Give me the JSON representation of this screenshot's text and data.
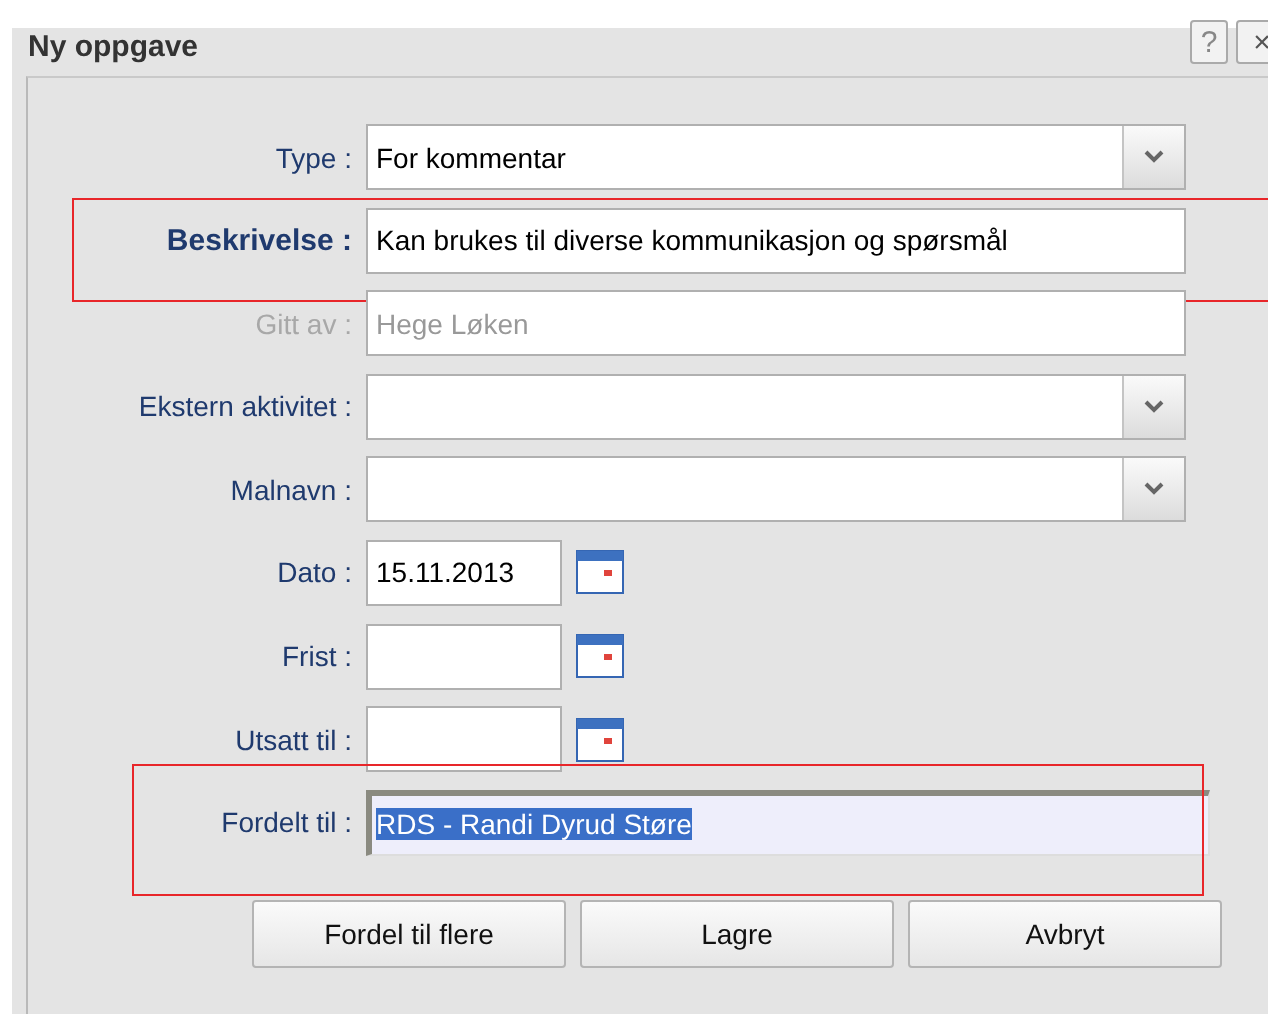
{
  "window": {
    "title": "Ny oppgave"
  },
  "title_buttons": [
    {
      "kind": "help",
      "label": "?"
    },
    {
      "kind": "close",
      "label": "×"
    }
  ],
  "fields": [
    {
      "kind": "dropdown",
      "label": "Type :",
      "value": "For kommentar",
      "emphasized": false,
      "disabled": false,
      "highlighted": false,
      "text_selected": false
    },
    {
      "kind": "text",
      "label": "Beskrivelse :",
      "value": "Kan brukes til diverse kommunikasjon og spørsmål",
      "emphasized": true,
      "disabled": false,
      "highlighted": true,
      "text_selected": false
    },
    {
      "kind": "text",
      "label": "Gitt av :",
      "value": "Hege Løken",
      "emphasized": false,
      "disabled": true,
      "highlighted": false,
      "text_selected": false
    },
    {
      "kind": "dropdown",
      "label": "Ekstern aktivitet :",
      "emphasized": false,
      "disabled": false,
      "highlighted": false,
      "text_selected": false
    },
    {
      "kind": "dropdown",
      "label": "Malnavn :",
      "emphasized": false,
      "disabled": false,
      "highlighted": false,
      "text_selected": false
    },
    {
      "kind": "date",
      "label": "Dato :",
      "value": "15.11.2013",
      "emphasized": false,
      "disabled": false,
      "highlighted": false,
      "text_selected": false
    },
    {
      "kind": "date",
      "label": "Frist :",
      "emphasized": false,
      "disabled": false,
      "highlighted": false,
      "text_selected": false
    },
    {
      "kind": "date",
      "label": "Utsatt til :",
      "emphasized": false,
      "disabled": false,
      "highlighted": false,
      "text_selected": false
    },
    {
      "kind": "focused",
      "label": "Fordelt til :",
      "value": "RDS - Randi Dyrud Støre",
      "emphasized": false,
      "disabled": false,
      "highlighted": true,
      "text_selected": true
    }
  ],
  "buttons": [
    "Fordel til flere",
    "Lagre",
    "Avbryt"
  ]
}
